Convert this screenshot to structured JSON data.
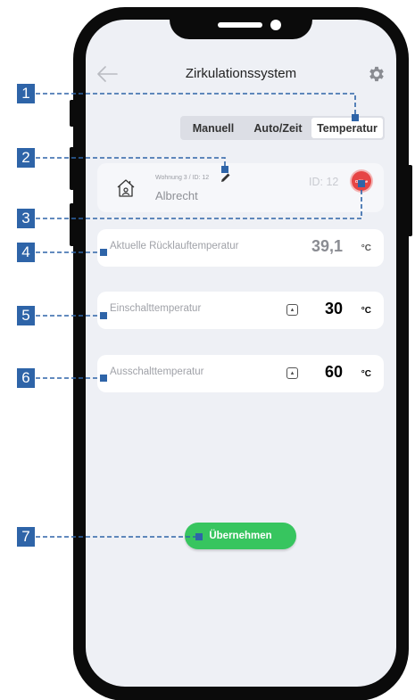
{
  "header": {
    "title": "Zirkulationssystem",
    "back_icon": "arrow-left-icon",
    "settings_icon": "gear-icon"
  },
  "tabs": [
    {
      "label": "Manuell",
      "active": false
    },
    {
      "label": "Auto/Zeit",
      "active": false
    },
    {
      "label": "Temperatur",
      "active": true
    }
  ],
  "device": {
    "sub_label": "Wohnung 3 / ID: 12",
    "name": "Albrecht",
    "id_text": "ID: 12",
    "status": "Offline",
    "icon": "house-icon"
  },
  "rows": [
    {
      "label": "Aktuelle Rücklauftemperatur",
      "value": "39,1",
      "unit": "°C"
    },
    {
      "label": "Einschalttemperatur",
      "value": "30",
      "unit": "°C"
    },
    {
      "label": "Ausschalttemperatur",
      "value": "60",
      "unit": "°C"
    }
  ],
  "apply_label": "Übernehmen",
  "annotations": [
    "1",
    "2",
    "3",
    "4",
    "5",
    "6",
    "7"
  ],
  "colors": {
    "annotation": "#2e64a8",
    "apply": "#37c55f",
    "offline": "#e64545",
    "screen_bg": "#eef0f5"
  }
}
